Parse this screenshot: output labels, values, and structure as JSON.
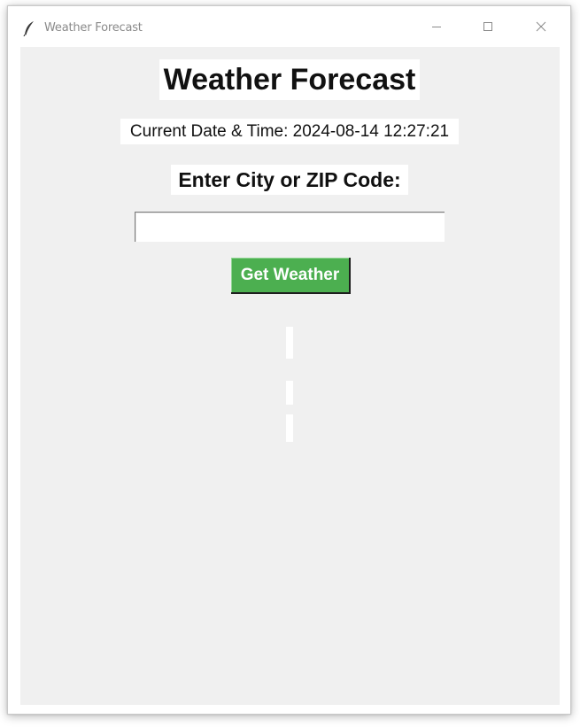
{
  "window": {
    "title": "Weather Forecast",
    "icon": "feather-icon",
    "controls": {
      "minimize": "minimize-icon",
      "maximize": "maximize-icon",
      "close": "close-icon"
    }
  },
  "main": {
    "heading": "Weather Forecast",
    "datetime": "Current Date & Time: 2024-08-14 12:27:21",
    "prompt_label": "Enter City or ZIP Code:",
    "city_input": {
      "value": "",
      "placeholder": ""
    },
    "get_weather_label": "Get Weather",
    "results": [
      "",
      "",
      ""
    ]
  },
  "colors": {
    "background": "#f0f0f0",
    "button": "#4caf50",
    "button_text": "#ffffff",
    "label_background": "#ffffff"
  }
}
